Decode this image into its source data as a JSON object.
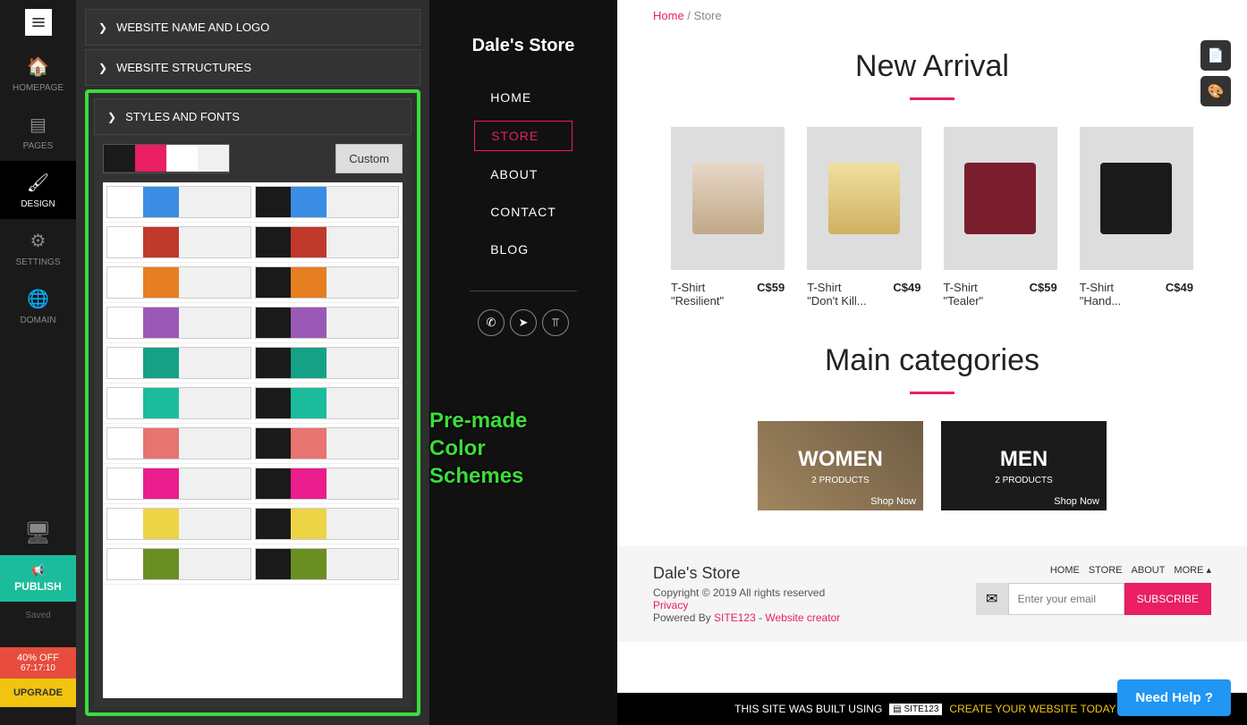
{
  "sidebar": {
    "items": [
      "HOMEPAGE",
      "PAGES",
      "DESIGN",
      "SETTINGS",
      "DOMAIN"
    ],
    "publish": "PUBLISH",
    "saved": "Saved",
    "offer_line1": "40% OFF",
    "offer_line2": "67:17:10",
    "upgrade": "UPGRADE"
  },
  "accordion": {
    "name_logo": "WEBSITE NAME AND LOGO",
    "structures": "WEBSITE STRUCTURES",
    "styles_fonts": "STYLES AND FONTS",
    "custom_btn": "Custom"
  },
  "current_scheme": [
    "#1a1a1a",
    "#e91e63",
    "#ffffff",
    "#f0f0f0"
  ],
  "color_schemes": [
    {
      "accent": "#3b8de3",
      "light_bg": "#ffffff",
      "dark_bg": "#1a1a1a",
      "neutral": "#f0f0f0"
    },
    {
      "accent": "#c0392b",
      "light_bg": "#ffffff",
      "dark_bg": "#1a1a1a",
      "neutral": "#f0f0f0"
    },
    {
      "accent": "#e67e22",
      "light_bg": "#ffffff",
      "dark_bg": "#1a1a1a",
      "neutral": "#f0f0f0"
    },
    {
      "accent": "#9b59b6",
      "light_bg": "#ffffff",
      "dark_bg": "#1a1a1a",
      "neutral": "#f0f0f0"
    },
    {
      "accent": "#16a085",
      "light_bg": "#ffffff",
      "dark_bg": "#1a1a1a",
      "neutral": "#f0f0f0"
    },
    {
      "accent": "#1abc9c",
      "light_bg": "#ffffff",
      "dark_bg": "#1a1a1a",
      "neutral": "#f0f0f0"
    },
    {
      "accent": "#e77471",
      "light_bg": "#ffffff",
      "dark_bg": "#1a1a1a",
      "neutral": "#f0f0f0"
    },
    {
      "accent": "#e91e8c",
      "light_bg": "#ffffff",
      "dark_bg": "#1a1a1a",
      "neutral": "#f0f0f0"
    },
    {
      "accent": "#ecd447",
      "light_bg": "#ffffff",
      "dark_bg": "#1a1a1a",
      "neutral": "#f0f0f0"
    },
    {
      "accent": "#6b8e23",
      "light_bg": "#ffffff",
      "dark_bg": "#1a1a1a",
      "neutral": "#f0f0f0"
    }
  ],
  "annotation": {
    "line1": "Pre-made",
    "line2": "Color",
    "line3": "Schemes"
  },
  "preview": {
    "store_name": "Dale's Store",
    "nav": [
      "HOME",
      "STORE",
      "ABOUT",
      "CONTACT",
      "BLOG"
    ],
    "breadcrumb_home": "Home",
    "breadcrumb_sep": " / ",
    "breadcrumb_current": "Store",
    "section_new_arrival": "New Arrival",
    "section_categories": "Main categories",
    "products": [
      {
        "name": "T-Shirt \"Resilient\"",
        "price": "C$59"
      },
      {
        "name": "T-Shirt \"Don't Kill...",
        "price": "C$49"
      },
      {
        "name": "T-Shirt \"Tealer\"",
        "price": "C$59"
      },
      {
        "name": "T-Shirt \"Hand...",
        "price": "C$49"
      }
    ],
    "categories": [
      {
        "name": "WOMEN",
        "count": "2 PRODUCTS",
        "shop": "Shop Now"
      },
      {
        "name": "MEN",
        "count": "2 PRODUCTS",
        "shop": "Shop Now"
      }
    ]
  },
  "footer": {
    "store_name": "Dale's Store",
    "copyright": "Copyright © 2019 All rights reserved",
    "privacy": "Privacy",
    "powered_by": "Powered By ",
    "site123": "SITE123",
    "dash": " - ",
    "website_creator": "Website creator",
    "nav": [
      "HOME",
      "STORE",
      "ABOUT",
      "MORE ▴"
    ],
    "email_placeholder": "Enter your email",
    "subscribe": "SUBSCRIBE"
  },
  "banner": {
    "text1": "THIS SITE WAS BUILT USING",
    "badge": "▤ SITE123",
    "text2": "CREATE YOUR WEBSITE TODAY ▸▸"
  },
  "help": "Need Help ?"
}
